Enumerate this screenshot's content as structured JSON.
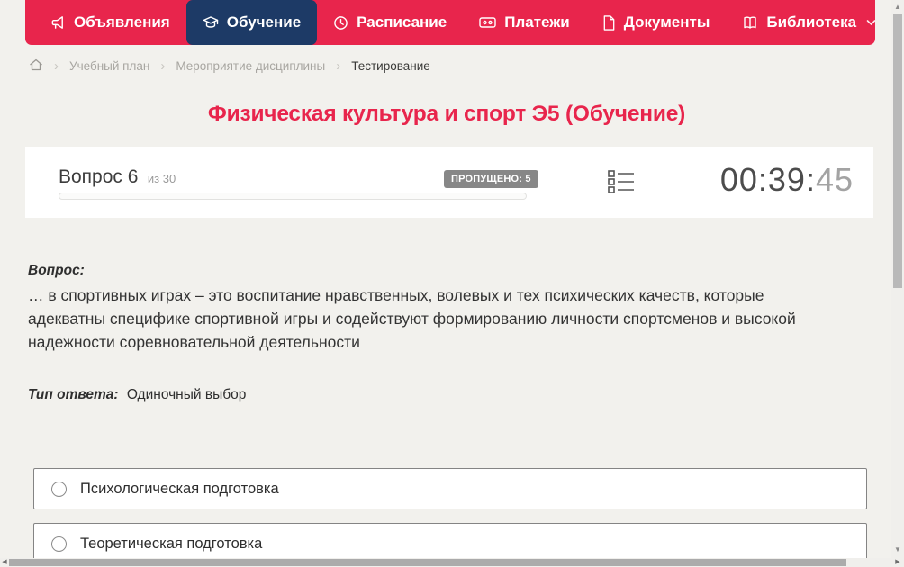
{
  "colors": {
    "accent_red": "#e8254c",
    "active_navy": "#1d3a66",
    "badge_gray": "#878787",
    "page_bg": "#f2f1ed"
  },
  "nav": {
    "items": [
      {
        "label": "Объявления",
        "icon": "megaphone-icon",
        "active": false
      },
      {
        "label": "Обучение",
        "icon": "graduation-cap-icon",
        "active": true
      },
      {
        "label": "Расписание",
        "icon": "clock-icon",
        "active": false
      },
      {
        "label": "Платежи",
        "icon": "credit-card-icon",
        "active": false
      },
      {
        "label": "Документы",
        "icon": "document-icon",
        "active": false
      },
      {
        "label": "Библиотека",
        "icon": "book-icon",
        "active": false,
        "has_dropdown": true
      }
    ]
  },
  "breadcrumb": {
    "home_icon": "home-icon",
    "items": [
      {
        "label": "Учебный план",
        "current": false
      },
      {
        "label": "Мероприятие дисциплины",
        "current": false
      },
      {
        "label": "Тестирование",
        "current": true
      }
    ]
  },
  "page": {
    "title": "Физическая культура и спорт Э5 (Обучение)"
  },
  "question_panel": {
    "question_label": "Вопрос 6",
    "question_of": "из 30",
    "skipped_badge": "ПРОПУЩЕНО: 5",
    "progress_percent": 0,
    "list_icon": "question-list-icon",
    "timer_main": "00:39:",
    "timer_seconds": "45"
  },
  "question": {
    "label": "Вопрос:",
    "text": "… в спортивных играх – это воспитание нравственных, волевых и тех психических качеств, которые адекватны специфике спортивной игры и содействуют формированию личности спортсменов и высокой надежности соревновательной деятельности",
    "answer_type_label": "Тип ответа:",
    "answer_type_value": "Одиночный выбор",
    "options": [
      {
        "label": "Психологическая подготовка",
        "selected": false
      },
      {
        "label": "Теоретическая подготовка",
        "selected": false
      }
    ]
  },
  "scrollbars": {
    "vertical_up": "▲",
    "vertical_down": "▼",
    "horizontal_left": "◀",
    "horizontal_right": "▶"
  }
}
